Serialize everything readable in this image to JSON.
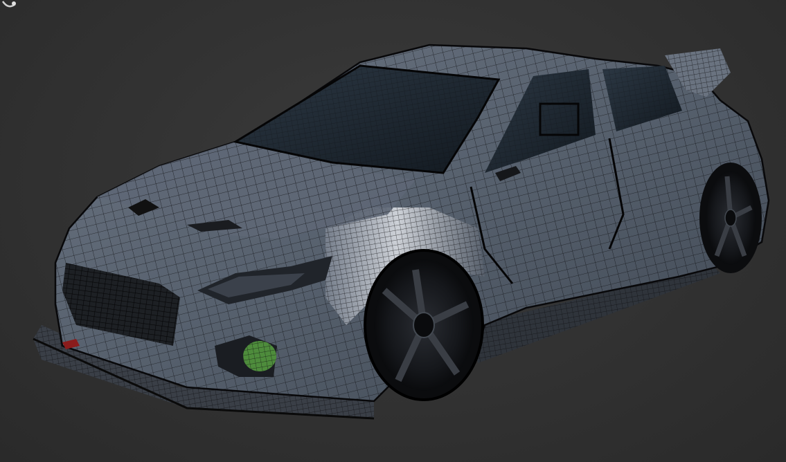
{
  "viewport": {
    "background": "#333333",
    "model": {
      "body_color": "#5c6472",
      "highlight_color": "#d9dde3",
      "wire_color": "#0c0c0e",
      "glass_color": "#1c2630",
      "fog_light_color": "#4e8c3c"
    },
    "icons": {
      "navigation_gizmo": "view-gizmo-icon"
    }
  }
}
